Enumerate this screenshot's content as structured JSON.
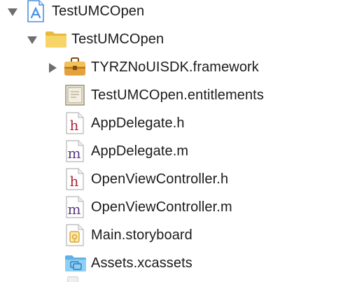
{
  "navigator": {
    "items": [
      {
        "label": "TestUMCOpen",
        "kind": "project",
        "icon": "xcode-project-icon",
        "expanded": true
      },
      {
        "label": "TestUMCOpen",
        "kind": "group",
        "icon": "folder-icon",
        "expanded": true
      },
      {
        "label": "TYRZNoUISDK.framework",
        "kind": "framework",
        "icon": "framework-toolbox-icon",
        "expanded": false
      },
      {
        "label": "TestUMCOpen.entitlements",
        "kind": "file",
        "icon": "entitlements-certificate-icon"
      },
      {
        "label": "AppDelegate.h",
        "kind": "file",
        "icon": "header-file-icon",
        "glyph": "h"
      },
      {
        "label": "AppDelegate.m",
        "kind": "file",
        "icon": "objc-source-file-icon",
        "glyph": "m"
      },
      {
        "label": "OpenViewController.h",
        "kind": "file",
        "icon": "header-file-icon",
        "glyph": "h"
      },
      {
        "label": "OpenViewController.m",
        "kind": "file",
        "icon": "objc-source-file-icon",
        "glyph": "m"
      },
      {
        "label": "Main.storyboard",
        "kind": "file",
        "icon": "storyboard-file-icon"
      },
      {
        "label": "Assets.xcassets",
        "kind": "folder",
        "icon": "asset-catalog-folder-icon"
      }
    ],
    "colors": {
      "disclosure": "#6e6e6e",
      "header_glyph": "#b0273a",
      "source_glyph": "#5b3a86",
      "folder": "#f2c94c",
      "asset_folder": "#7fc3ef",
      "project": "#4a90e2"
    }
  }
}
